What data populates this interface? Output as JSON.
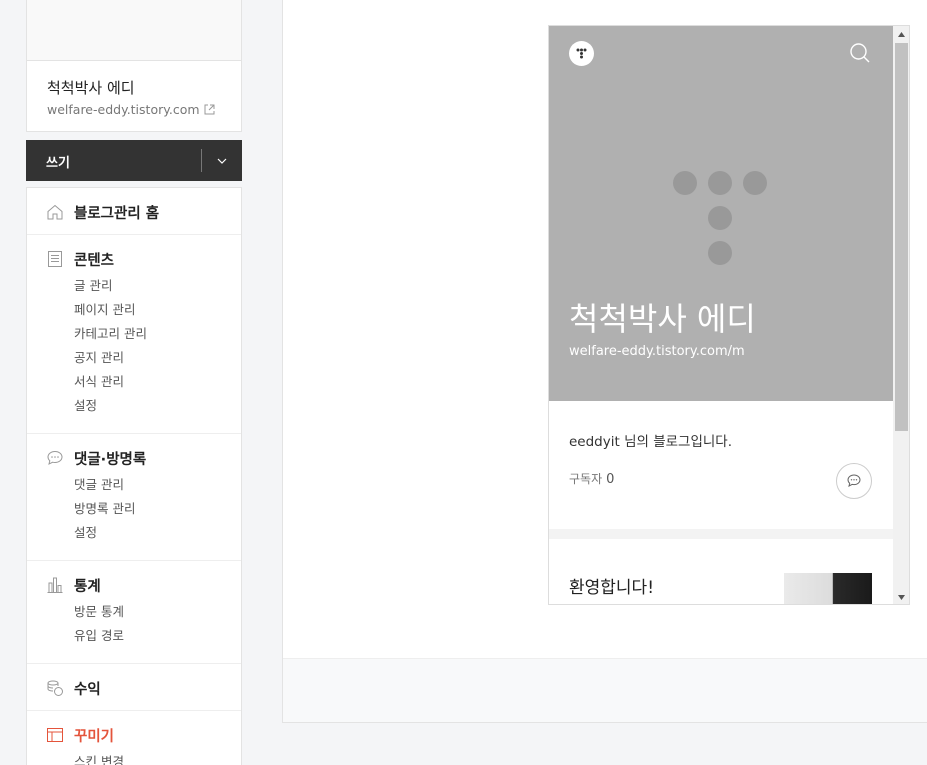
{
  "blog": {
    "name": "척척박사 에디",
    "url": "welfare-eddy.tistory.com"
  },
  "write": {
    "label": "쓰기"
  },
  "menu": {
    "home": {
      "label": "블로그관리 홈",
      "icon": "home-icon"
    },
    "content": {
      "label": "콘텐츠",
      "icon": "document-icon",
      "items": [
        "글 관리",
        "페이지 관리",
        "카테고리 관리",
        "공지 관리",
        "서식 관리",
        "설정"
      ]
    },
    "comments": {
      "label": "댓글·방명록",
      "icon": "speech-bubble-icon",
      "items": [
        "댓글 관리",
        "방명록 관리",
        "설정"
      ]
    },
    "stats": {
      "label": "통계",
      "icon": "bar-chart-icon",
      "items": [
        "방문 통계",
        "유입 경로"
      ]
    },
    "revenue": {
      "label": "수익",
      "icon": "coins-icon"
    },
    "design": {
      "label": "꾸미기",
      "icon": "layout-icon",
      "items": [
        "스킨 변경"
      ]
    }
  },
  "preview": {
    "title": "척척박사 에디",
    "url": "welfare-eddy.tistory.com/m",
    "intro": "eeddyit 님의 블로그입니다.",
    "subscribers_label": "구독자",
    "subscribers_count": "0",
    "post_title": "환영합니다!"
  },
  "colors": {
    "accent_red": "#e4543b",
    "write_bar": "#333333",
    "hero_bg": "#b0b0b0"
  }
}
